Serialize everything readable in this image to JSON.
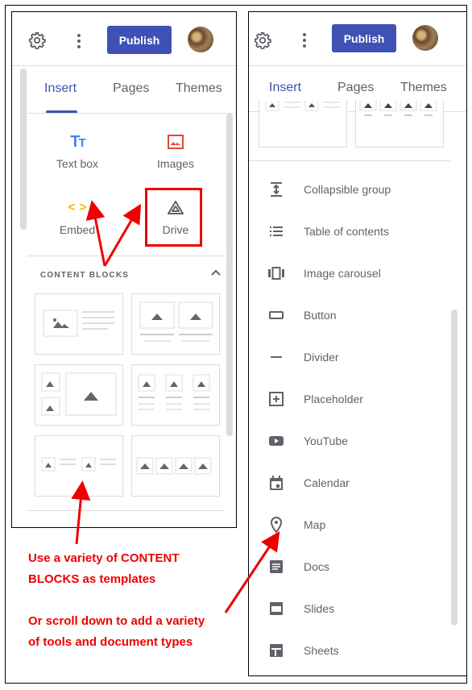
{
  "header": {
    "publish_label": "Publish"
  },
  "tabs": [
    {
      "label": "Insert",
      "active": true
    },
    {
      "label": "Pages"
    },
    {
      "label": "Themes"
    }
  ],
  "insert_tools": [
    {
      "label": "Text box",
      "icon": "text-box-icon",
      "color": "#4285f4"
    },
    {
      "label": "Images",
      "icon": "image-icon",
      "color": "#ea4335"
    },
    {
      "label": "Embed",
      "icon": "embed-icon",
      "color": "#fbbc04"
    },
    {
      "label": "Drive",
      "icon": "drive-icon",
      "color": "#5f6368"
    }
  ],
  "content_blocks": {
    "title": "CONTENT BLOCKS",
    "expanded": true
  },
  "components": [
    {
      "label": "Collapsible group",
      "icon": "collapsible-group-icon"
    },
    {
      "label": "Table of contents",
      "icon": "table-of-contents-icon"
    },
    {
      "label": "Image carousel",
      "icon": "image-carousel-icon"
    },
    {
      "label": "Button",
      "icon": "button-icon"
    },
    {
      "label": "Divider",
      "icon": "divider-icon"
    },
    {
      "label": "Placeholder",
      "icon": "placeholder-icon"
    },
    {
      "label": "YouTube",
      "icon": "youtube-icon"
    },
    {
      "label": "Calendar",
      "icon": "calendar-icon"
    },
    {
      "label": "Map",
      "icon": "map-pin-icon"
    },
    {
      "label": "Docs",
      "icon": "docs-icon"
    },
    {
      "label": "Slides",
      "icon": "slides-icon"
    },
    {
      "label": "Sheets",
      "icon": "sheets-icon"
    }
  ],
  "annotations": {
    "line1": "Use a variety of CONTENT",
    "line2": "BLOCKS as templates",
    "line3": "Or scroll down to add a variety",
    "line4": "of tools and document types",
    "color": "#e00000"
  },
  "colors": {
    "accent": "#3f51b5"
  }
}
